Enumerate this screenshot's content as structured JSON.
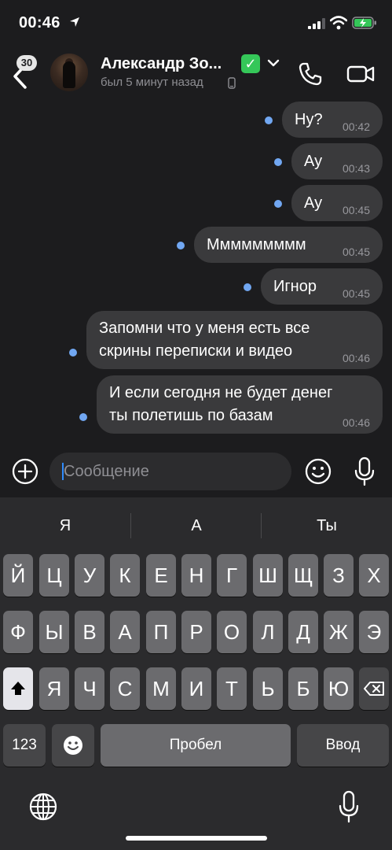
{
  "status": {
    "time": "00:46"
  },
  "header": {
    "back_count": "30",
    "contact_name": "Александр Зо...",
    "verified_emoji": "✓",
    "last_seen": "был 5 минут назад",
    "icons": [
      "back-chevron-icon",
      "call-icon",
      "video-call-icon",
      "chevron-down-icon",
      "mobile-phone-icon"
    ]
  },
  "messages": [
    {
      "text": "Ну?",
      "time": "00:42"
    },
    {
      "text": "Ау",
      "time": "00:43"
    },
    {
      "text": "Ау",
      "time": "00:45"
    },
    {
      "text": "Ммммммммм",
      "time": "00:45"
    },
    {
      "text": "Игнор",
      "time": "00:45"
    },
    {
      "line1": "Запомни что у меня есть все",
      "line2": "скрины переписки и видео",
      "time": "00:46"
    },
    {
      "line1": "И если сегодня не будет денег",
      "line2": "ты полетишь по базам",
      "time": "00:46"
    }
  ],
  "composer": {
    "placeholder": "Сообщение"
  },
  "keyboard": {
    "suggestions": [
      "Я",
      "А",
      "Ты"
    ],
    "row1": [
      "Й",
      "Ц",
      "У",
      "К",
      "Е",
      "Н",
      "Г",
      "Ш",
      "Щ",
      "З",
      "Х"
    ],
    "row2": [
      "Ф",
      "Ы",
      "В",
      "А",
      "П",
      "Р",
      "О",
      "Л",
      "Д",
      "Ж",
      "Э"
    ],
    "row3": [
      "Я",
      "Ч",
      "С",
      "М",
      "И",
      "Т",
      "Ь",
      "Б",
      "Ю"
    ],
    "numbers_label": "123",
    "space_label": "Пробел",
    "return_label": "Ввод"
  },
  "colors": {
    "background": "#1c1c1e",
    "bubble": "#3a3a3c",
    "read_dot": "#71a7f2",
    "verified": "#35c759",
    "keyboard": "#2b2b2d"
  }
}
